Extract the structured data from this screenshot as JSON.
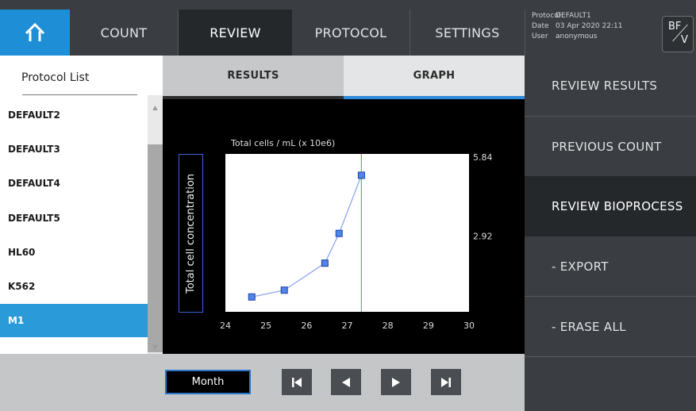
{
  "topbar": {
    "home_icon": "home-icon",
    "tabs": [
      "COUNT",
      "REVIEW",
      "PROTOCOL",
      "SETTINGS"
    ],
    "active_tab": "REVIEW",
    "info": {
      "protocol_label": "Protocol",
      "protocol_value": "DEFAULT1",
      "date_label": "Date",
      "date_value": "03 Apr 2020 22:11",
      "user_label": "User",
      "user_value": "anonymous"
    },
    "mode_badge": {
      "top": "BF",
      "bottom": "V"
    }
  },
  "protocol_list": {
    "title": "Protocol List",
    "items": [
      "DEFAULT2",
      "DEFAULT3",
      "DEFAULT4",
      "DEFAULT5",
      "HL60",
      "K562",
      "M1"
    ],
    "selected": "M1"
  },
  "subtabs": {
    "results": "RESULTS",
    "graph": "GRAPH",
    "active": "GRAPH"
  },
  "chart_data": {
    "type": "line",
    "title": "Total cells / mL (x 10e6)",
    "ylabel": "Total cell concentration",
    "xlim": [
      24,
      30
    ],
    "ylim": [
      0,
      5.84
    ],
    "x_ticks": [
      "24",
      "25",
      "26",
      "27",
      "28",
      "29",
      "30"
    ],
    "y_ticks": [
      "5.84",
      "2.92"
    ],
    "series": [
      {
        "x": [
          24.65,
          25.45,
          26.45,
          26.8,
          27.35
        ],
        "y": [
          0.55,
          0.8,
          1.8,
          2.9,
          5.05
        ]
      }
    ],
    "marker_line_x": 27.35,
    "colors": {
      "line": "#8fa8f0",
      "marker": "#4f86ea",
      "marker_edge": "#1d3fa8",
      "vline": "#35d435",
      "plot_bg": "#ffffff",
      "area_bg": "#000000"
    }
  },
  "bottom_bar": {
    "period_button": "Month",
    "nav_icons": [
      "skip-to-first-icon",
      "previous-icon",
      "next-icon",
      "skip-to-last-icon"
    ]
  },
  "right_menu": {
    "items": [
      "REVIEW RESULTS",
      "PREVIOUS COUNT",
      "REVIEW BIOPROCESS",
      "- EXPORT",
      "- ERASE ALL"
    ],
    "active": "REVIEW BIOPROCESS"
  },
  "colors": {
    "accent_blue": "#2b9ad8",
    "topbar_bg": "#3a3d41",
    "active_tab_bg": "#25282b"
  }
}
